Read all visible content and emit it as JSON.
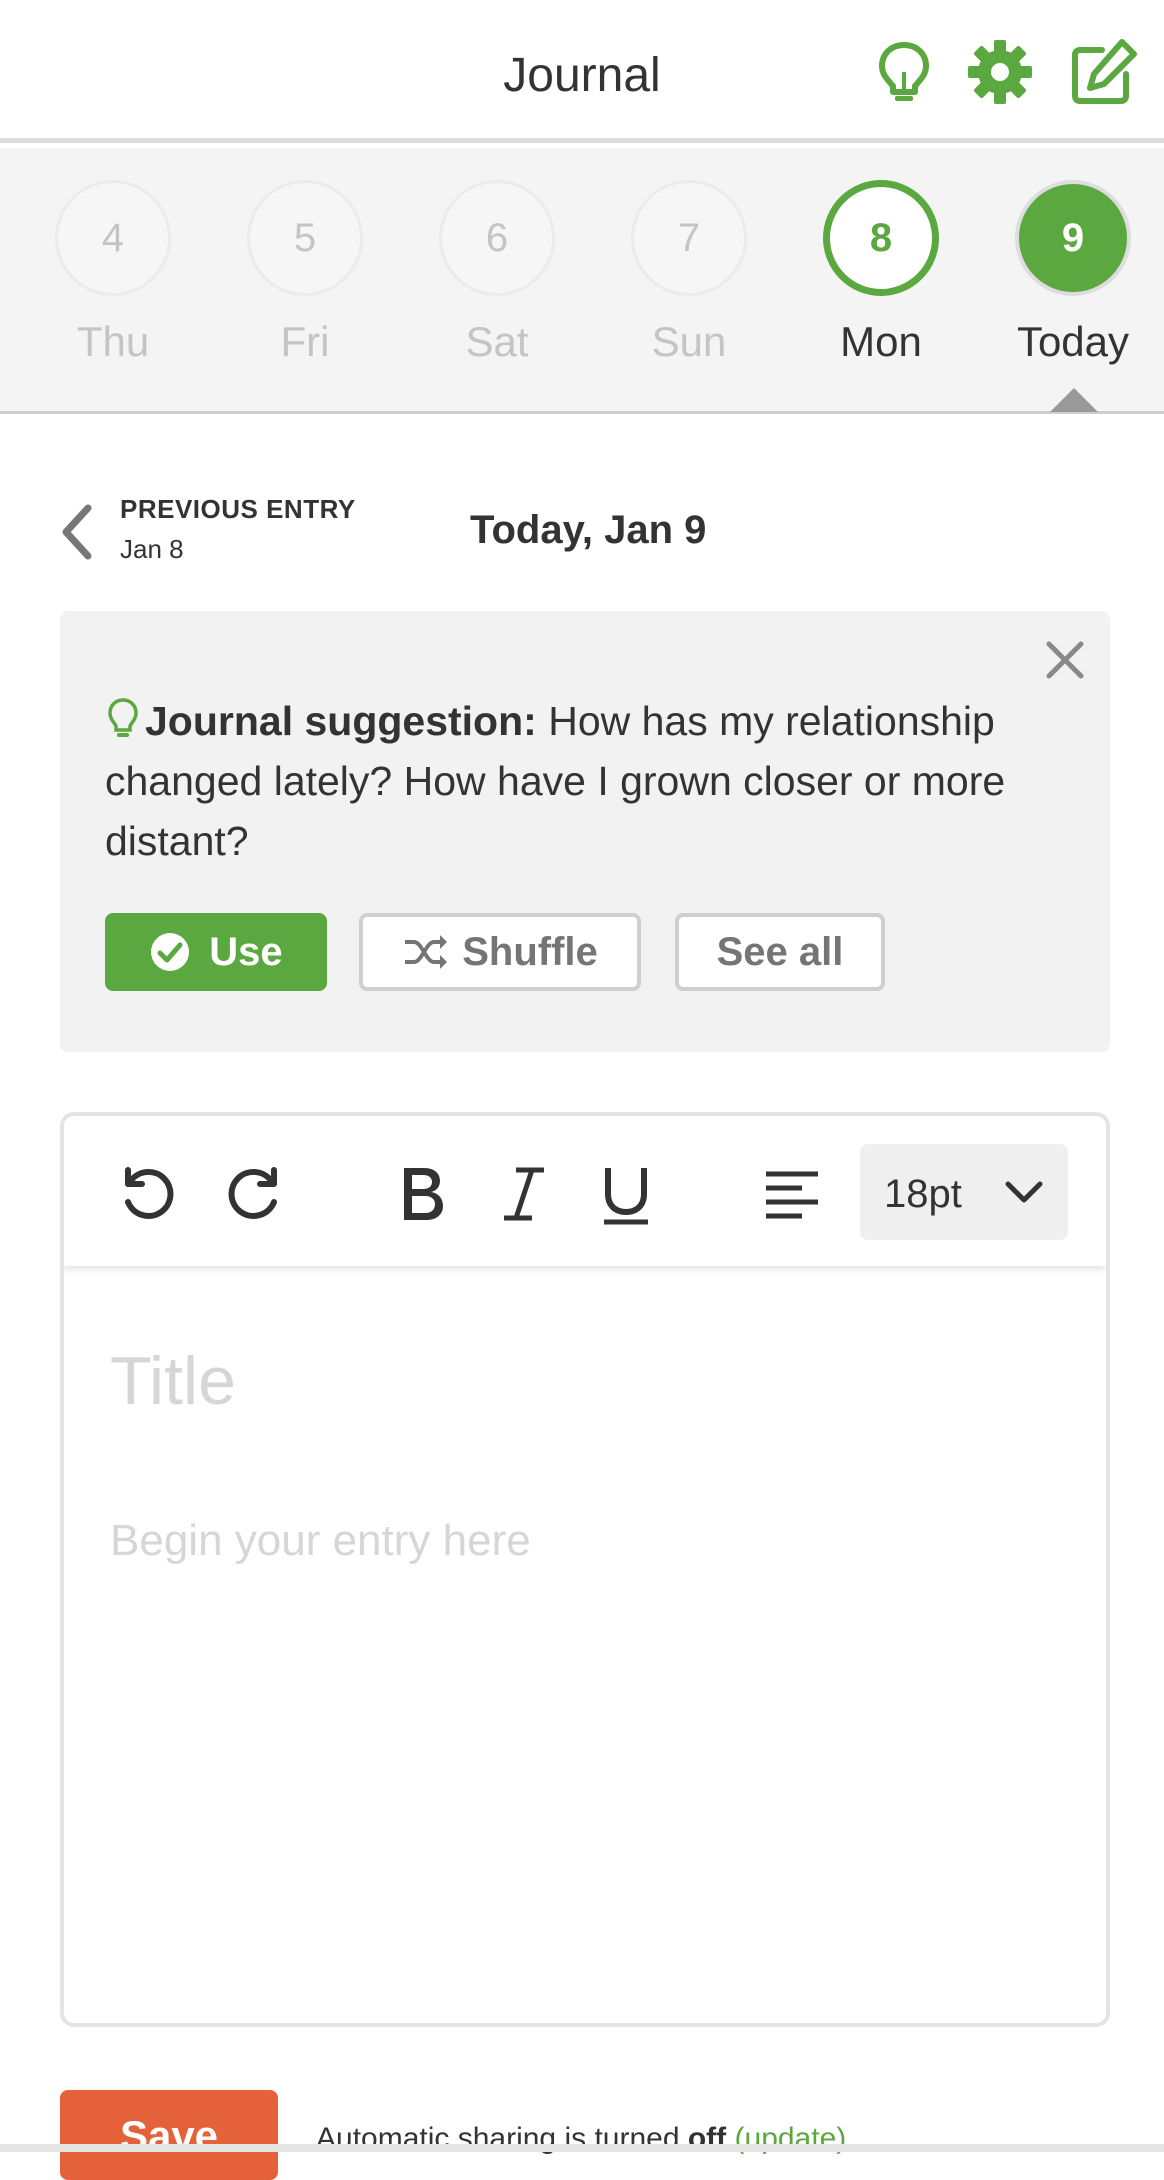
{
  "header": {
    "title": "Journal",
    "icons": [
      "lightbulb-icon",
      "gear-icon",
      "edit-icon"
    ]
  },
  "colors": {
    "accent": "#5aa83f",
    "save": "#e4613a",
    "muted": "#c4c4c4",
    "card_bg": "#f2f2f2"
  },
  "days": [
    {
      "number": "4",
      "label": "Thu",
      "state": "inactive"
    },
    {
      "number": "5",
      "label": "Fri",
      "state": "inactive"
    },
    {
      "number": "6",
      "label": "Sat",
      "state": "inactive"
    },
    {
      "number": "7",
      "label": "Sun",
      "state": "inactive"
    },
    {
      "number": "8",
      "label": "Mon",
      "state": "has-entry"
    },
    {
      "number": "9",
      "label": "Today",
      "state": "selected"
    }
  ],
  "entry_nav": {
    "previous_label": "PREVIOUS ENTRY",
    "previous_date": "Jan 8",
    "current_date": "Today, Jan 9"
  },
  "suggestion": {
    "heading": "Journal suggestion:",
    "text": " How has my relationship changed lately? How have I grown closer or more distant?",
    "use_label": "Use",
    "shuffle_label": "Shuffle",
    "see_all_label": "See all"
  },
  "editor": {
    "font_size": "18pt",
    "title_placeholder": "Title",
    "body_placeholder": "Begin your entry here"
  },
  "footer": {
    "save_label": "Save",
    "sharing_prefix": "Automatic sharing is turned ",
    "sharing_state": "off",
    "sharing_link": "(update)"
  }
}
